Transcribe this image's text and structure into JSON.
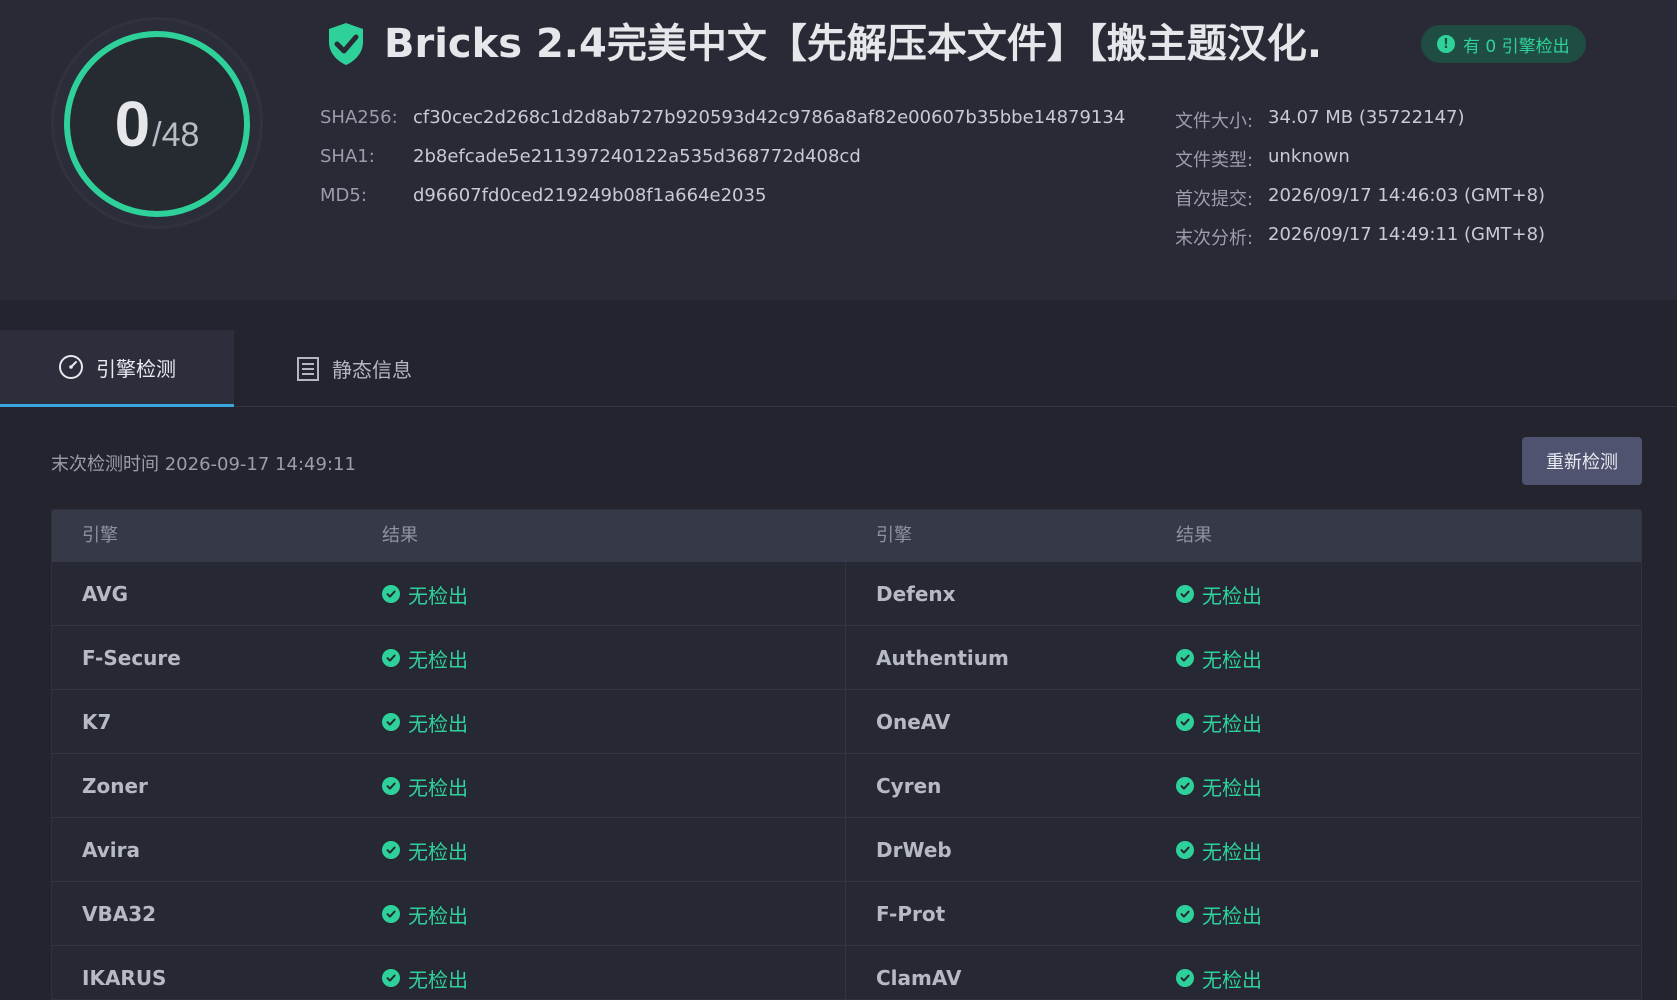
{
  "summary": {
    "detections": "0",
    "total": "/48",
    "title": "Bricks 2.4完美中文【先解压本文件】【搬主题汉化...",
    "badge": "有 0 引擎检出"
  },
  "hashes": [
    {
      "label": "SHA256:",
      "value": "cf30cec2d268c1d2d8ab727b920593d42c9786a8af82e00607b35bbe14879134"
    },
    {
      "label": "SHA1:",
      "value": "2b8efcade5e211397240122a535d368772d408cd"
    },
    {
      "label": "MD5:",
      "value": "d96607fd0ced219249b08f1a664e2035"
    }
  ],
  "meta": [
    {
      "label": "文件大小:",
      "value": "34.07 MB (35722147)"
    },
    {
      "label": "文件类型:",
      "value": "unknown"
    },
    {
      "label": "首次提交:",
      "value": "2026/09/17 14:46:03 (GMT+8)"
    },
    {
      "label": "末次分析:",
      "value": "2026/09/17 14:49:11 (GMT+8)"
    }
  ],
  "tabs": [
    {
      "label": "引擎检测",
      "active": true,
      "icon": "gauge-icon"
    },
    {
      "label": "静态信息",
      "active": false,
      "icon": "list-icon"
    }
  ],
  "last_scan": "末次检测时间 2026-09-17 14:49:11",
  "rescan_label": "重新检测",
  "table": {
    "headers": [
      "引擎",
      "结果",
      "引擎",
      "结果"
    ],
    "rows": [
      {
        "left_engine": "AVG",
        "left_result": "无检出",
        "right_engine": "Defenx",
        "right_result": "无检出"
      },
      {
        "left_engine": "F-Secure",
        "left_result": "无检出",
        "right_engine": "Authentium",
        "right_result": "无检出"
      },
      {
        "left_engine": "K7",
        "left_result": "无检出",
        "right_engine": "OneAV",
        "right_result": "无检出"
      },
      {
        "left_engine": "Zoner",
        "left_result": "无检出",
        "right_engine": "Cyren",
        "right_result": "无检出"
      },
      {
        "left_engine": "Avira",
        "left_result": "无检出",
        "right_engine": "DrWeb",
        "right_result": "无检出"
      },
      {
        "left_engine": "VBA32",
        "left_result": "无检出",
        "right_engine": "F-Prot",
        "right_result": "无检出"
      },
      {
        "left_engine": "IKARUS",
        "left_result": "无检出",
        "right_engine": "ClamAV",
        "right_result": "无检出"
      }
    ]
  },
  "colors": {
    "accent": "#2fd19b",
    "tab_underline": "#3aa6e0"
  }
}
